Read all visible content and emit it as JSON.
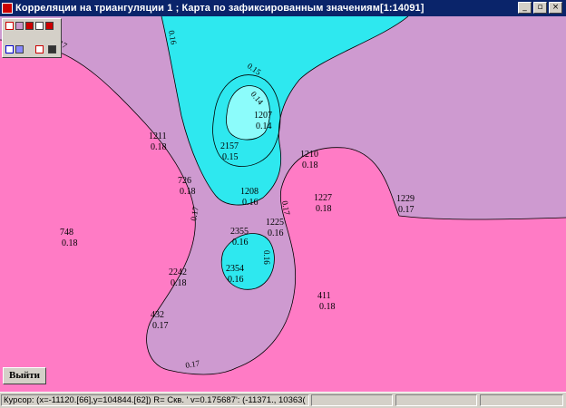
{
  "window": {
    "title": "Корреляции на триангуляции 1  ; Карта по зафиксированным значениям[1:14091]",
    "minimize": "_",
    "restore": "▫",
    "close": "×"
  },
  "colors": {
    "region_018": "#ff7bc5",
    "region_017": "#ce9ad0",
    "region_016": "#2ee8ef",
    "region_014": "#8cfcfb",
    "contour_line": "#000000"
  },
  "toolbar": {
    "icons": [
      "zoom-in-icon",
      "zoom-out-icon",
      "fit-icon",
      "pan-icon",
      "layers-icon",
      "grid-icon",
      "select-icon",
      "center-icon",
      "print-icon"
    ]
  },
  "wells": [
    {
      "id": "1207",
      "value": "0.14"
    },
    {
      "id": "2157",
      "value": "0.15"
    },
    {
      "id": "1211",
      "value": "0.18"
    },
    {
      "id": "726",
      "value": "0.18"
    },
    {
      "id": "1208",
      "value": "0.16"
    },
    {
      "id": "1210",
      "value": "0.18"
    },
    {
      "id": "1227",
      "value": "0.18"
    },
    {
      "id": "1229",
      "value": "0.17"
    },
    {
      "id": "748",
      "value": "0.18"
    },
    {
      "id": "1225",
      "value": "0.16"
    },
    {
      "id": "2355",
      "value": "0.16"
    },
    {
      "id": "2354",
      "value": "0.16"
    },
    {
      "id": "2242",
      "value": "0.18"
    },
    {
      "id": "411",
      "value": "0.18"
    },
    {
      "id": "432",
      "value": "0.17"
    }
  ],
  "contour_labels": [
    "0.17",
    "0.16",
    "0.15",
    "0.14",
    "0.17",
    "0.17",
    "0.16",
    "0.17"
  ],
  "exit_button": "Выйти",
  "status": {
    "text": "Курсор: (x=-11120.[66],y=104844.[62]) R= Скв. ' v=0.175687': (-11371., 10363("
  }
}
